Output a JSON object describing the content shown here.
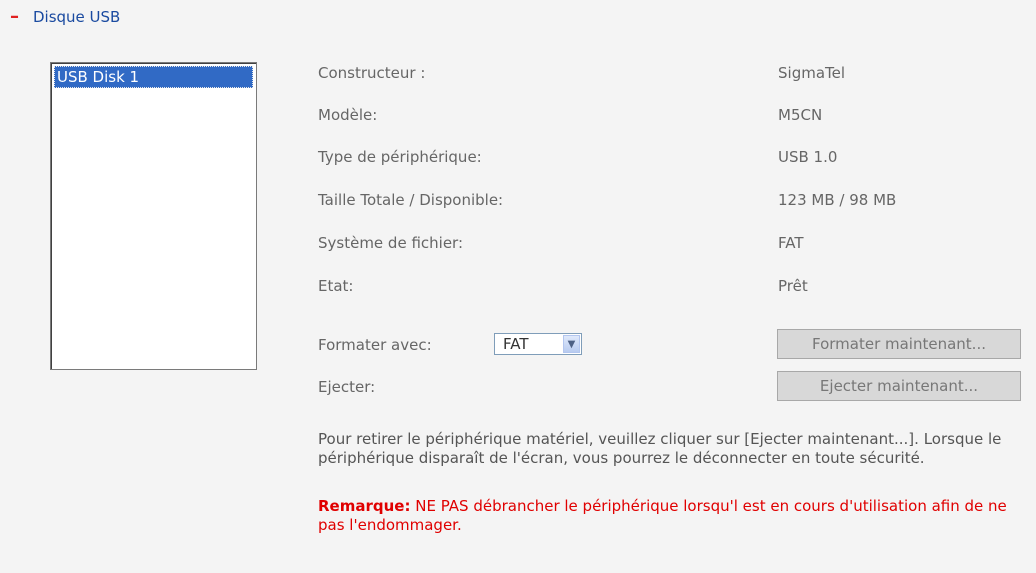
{
  "section": {
    "collapse_symbol": "–",
    "title": "Disque USB"
  },
  "devices": [
    "USB Disk 1"
  ],
  "details": [
    {
      "label": "Constructeur :",
      "value": "SigmaTel"
    },
    {
      "label": "Modèle:",
      "value": "M5CN"
    },
    {
      "label": "Type de périphérique:",
      "value": "USB 1.0"
    },
    {
      "label": "Taille Totale / Disponible:",
      "value": "123 MB / 98 MB"
    },
    {
      "label": "Système de fichier:",
      "value": "FAT"
    },
    {
      "label": "Etat:",
      "value": "Prêt"
    }
  ],
  "format": {
    "label": "Formater avec:",
    "selected": "FAT",
    "button": "Formater maintenant..."
  },
  "eject": {
    "label": "Ejecter:",
    "button": "Ejecter maintenant..."
  },
  "info_text": "Pour retirer le périphérique matériel, veuillez cliquer sur [Ejecter maintenant...]. Lorsque le périphérique disparaît de l'écran, vous pourrez le déconnecter en toute sécurité.",
  "note": {
    "prefix": "Remarque:",
    "text": " NE PAS débrancher le périphérique lorsqu'l est en cours d'utilisation afin de ne pas l'endommager."
  },
  "colors": {
    "accent": "#e02020",
    "title": "#1a4aa0",
    "selection": "#316ac5",
    "warning": "#e00000"
  }
}
